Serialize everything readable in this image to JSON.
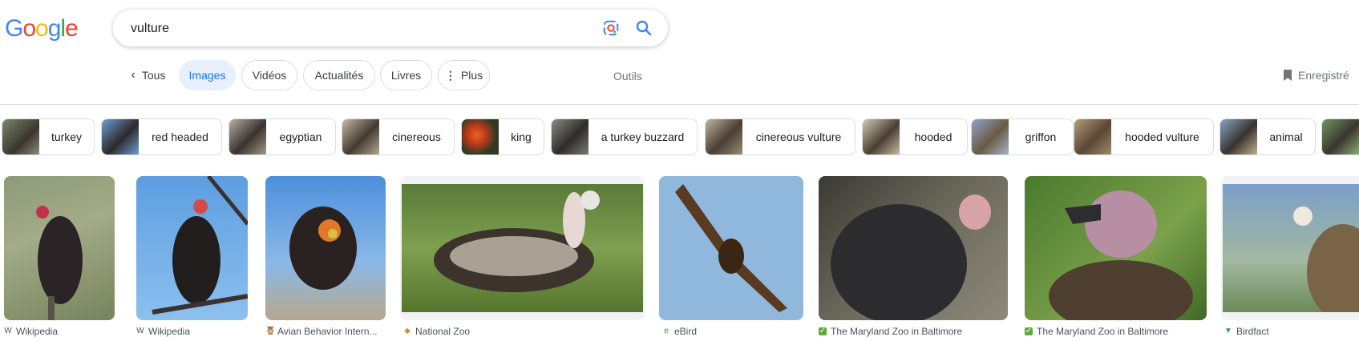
{
  "header": {
    "logo_letters": [
      "G",
      "o",
      "o",
      "g",
      "l",
      "e"
    ],
    "logo_colors": [
      "#4285F4",
      "#EA4335",
      "#FBBC05",
      "#4285F4",
      "#34A853",
      "#EA4335"
    ],
    "search_value": "vulture"
  },
  "tabs": {
    "back_label": "Tous",
    "items": [
      "Images",
      "Vidéos",
      "Actualités",
      "Livres"
    ],
    "more_label": "Plus",
    "tools_label": "Outils",
    "saved_label": "Enregistré"
  },
  "chips": [
    "turkey",
    "red headed",
    "egyptian",
    "cinereous",
    "king",
    "a turkey buzzard",
    "cinereous vulture",
    "hooded",
    "griffon",
    "hooded vulture",
    "animal"
  ],
  "results": [
    {
      "source": "Wikipedia",
      "favicon": "W"
    },
    {
      "source": "Wikipedia",
      "favicon": "W"
    },
    {
      "source": "Avian Behavior Intern...",
      "favicon": "🦉"
    },
    {
      "source": "National Zoo",
      "favicon": "◆"
    },
    {
      "source": "eBird",
      "favicon": "e"
    },
    {
      "source": "The Maryland Zoo in Baltimore",
      "favicon": "✓"
    },
    {
      "source": "The Maryland Zoo in Baltimore",
      "favicon": "✓"
    },
    {
      "source": "Birdfact",
      "favicon": "▼"
    }
  ],
  "colors": {
    "accent": "#1a73e8",
    "active_tab_bg": "#e8f0fe"
  }
}
